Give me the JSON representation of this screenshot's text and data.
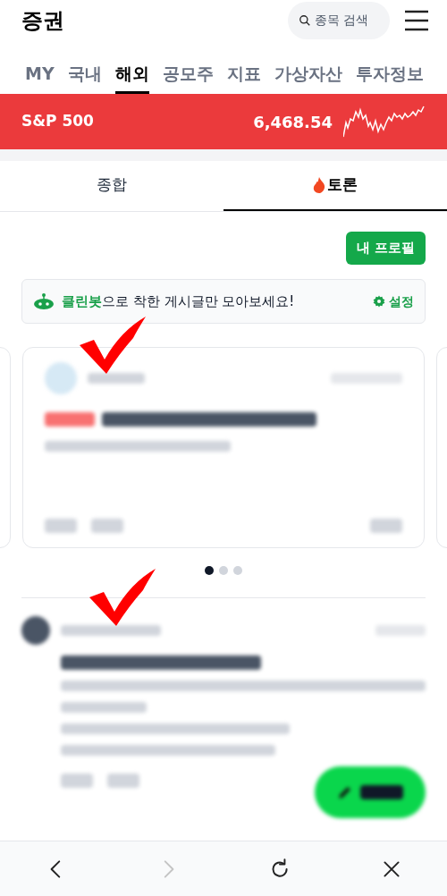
{
  "header": {
    "title": "증권",
    "search": {
      "placeholder": "종목 검색"
    }
  },
  "tabs": [
    {
      "label": "MY",
      "selected": false
    },
    {
      "label": "국내",
      "selected": false
    },
    {
      "label": "해외",
      "selected": true
    },
    {
      "label": "공모주",
      "selected": false
    },
    {
      "label": "지표",
      "selected": false
    },
    {
      "label": "가상자산",
      "selected": false
    },
    {
      "label": "투자정보",
      "selected": false
    }
  ],
  "ticker": {
    "name": "S&P 500",
    "value": "6,468.54"
  },
  "subtabs": [
    {
      "label": "종합",
      "selected": false,
      "icon": false
    },
    {
      "label": "토론",
      "selected": true,
      "icon": true
    }
  ],
  "profile_button": "내 프로필",
  "cleanbot": {
    "highlight": "클린봇",
    "text": "으로 착한 게시글만 모아보세요!",
    "settings": "설정"
  },
  "carousel": {
    "dots": [
      {
        "selected": true
      },
      {
        "selected": false
      },
      {
        "selected": false
      }
    ]
  },
  "nav": [
    {
      "kind": "back",
      "disabled": false
    },
    {
      "kind": "forward",
      "disabled": true
    },
    {
      "kind": "reload",
      "disabled": false
    },
    {
      "kind": "close",
      "disabled": false
    }
  ]
}
